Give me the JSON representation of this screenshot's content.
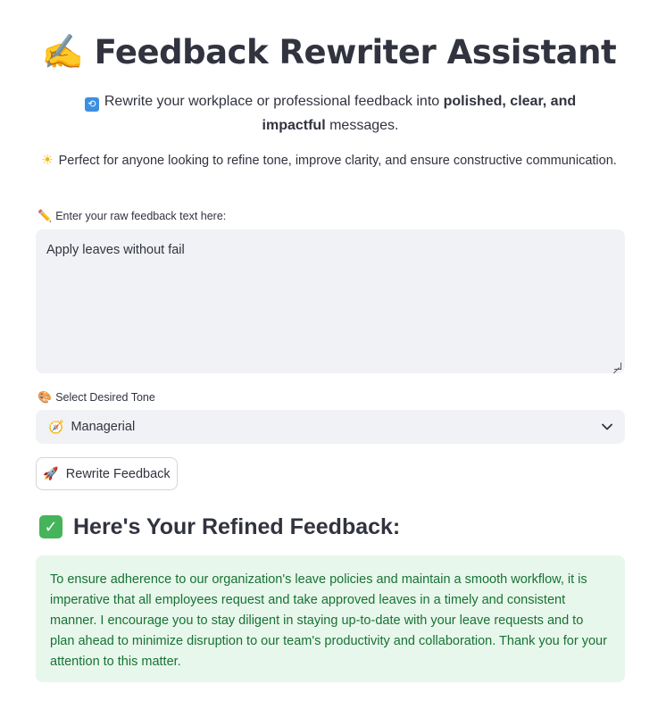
{
  "header": {
    "title_icon": "writing-hand-icon",
    "title": "Feedback Rewriter Assistant",
    "subtitle_icon": "refresh-icon",
    "subtitle_pre": "Rewrite your workplace or professional feedback into ",
    "subtitle_bold": "polished, clear, and impactful",
    "subtitle_post": " messages.",
    "tagline_icon": "sun-icon",
    "tagline": "Perfect for anyone looking to refine tone, improve clarity, and ensure constructive communication."
  },
  "input": {
    "label_icon": "pencil-icon",
    "label": "Enter your raw feedback text here:",
    "value": "Apply leaves without fail"
  },
  "tone": {
    "label_icon": "palette-icon",
    "label": "Select Desired Tone",
    "selected_icon": "compass-icon",
    "selected": "Managerial"
  },
  "action": {
    "button_icon": "rocket-icon",
    "button_label": "Rewrite Feedback"
  },
  "result": {
    "heading_icon": "check-mark-icon",
    "heading": "Here's Your Refined Feedback:",
    "text": "To ensure adherence to our organization's leave policies and maintain a smooth workflow, it is imperative that all employees request and take approved leaves in a timely and consistent manner. I encourage you to stay diligent in staying up-to-date with your leave requests and to plan ahead to minimize disruption to our team's productivity and collaboration. Thank you for your attention to this matter."
  },
  "colors": {
    "accent_green_text": "#177233",
    "success_bg": "#e8f7ec",
    "input_bg": "#f0f2f6"
  }
}
